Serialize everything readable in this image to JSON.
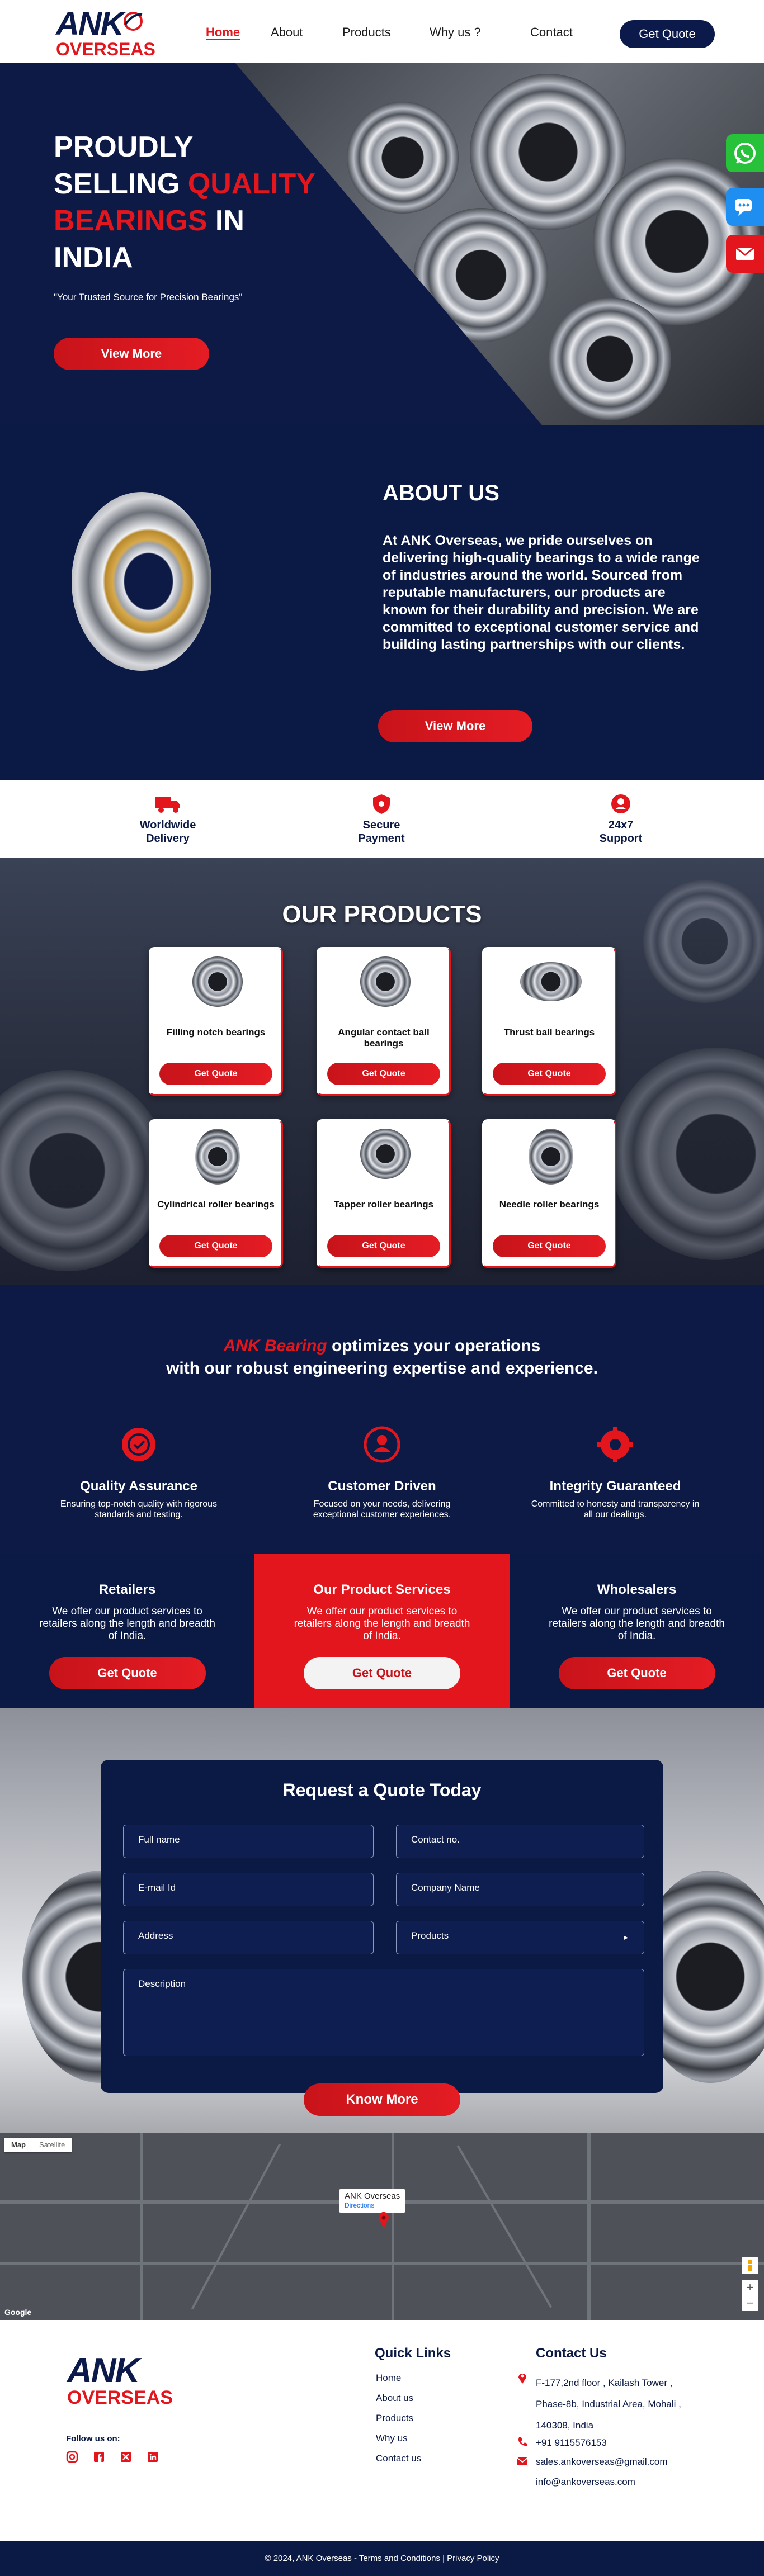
{
  "header": {
    "logo_top": "ANK",
    "logo_bottom": "OVERSEAS",
    "nav": [
      "Home",
      "About",
      "Products",
      "Why us ?",
      "Contact"
    ],
    "cta": "Get Quote"
  },
  "hero": {
    "line1": "PROUDLY",
    "line2a": "SELLING ",
    "line2b": "QUALITY",
    "line3a": "BEARINGS",
    "line3b": " IN",
    "line4": "INDIA",
    "tagline": "\"Your Trusted Source for Precision Bearings\"",
    "button": "View More"
  },
  "social": {
    "whatsapp": "whatsapp-icon",
    "chat": "chat-icon",
    "mail": "mail-icon"
  },
  "about": {
    "title": "ABOUT US",
    "text": "At ANK Overseas, we pride ourselves on delivering high-quality bearings to a wide range of industries around the world. Sourced from reputable manufacturers, our products are known for their durability and precision. We are committed to exceptional customer service and building lasting partnerships with our clients.",
    "button": "View More"
  },
  "features": [
    {
      "l1": "Worldwide",
      "l2": "Delivery",
      "icon": "truck-icon"
    },
    {
      "l1": "Secure",
      "l2": "Payment",
      "icon": "shield-icon"
    },
    {
      "l1": "24x7",
      "l2": "Support",
      "icon": "support-icon"
    }
  ],
  "products": {
    "title": "OUR PRODUCTS",
    "items": [
      {
        "name": "Filling notch bearings",
        "btn": "Get Quote"
      },
      {
        "name": "Angular contact ball bearings",
        "btn": "Get Quote"
      },
      {
        "name": "Thrust ball bearings",
        "btn": "Get Quote"
      },
      {
        "name": "Cylindrical roller bearings",
        "btn": "Get Quote"
      },
      {
        "name": "Tapper roller bearings",
        "btn": "Get Quote"
      },
      {
        "name": "Needle roller bearings",
        "btn": "Get Quote"
      }
    ]
  },
  "optimize": {
    "brand": "ANK Bearing",
    "line1": " optimizes your operations",
    "line2": "with our robust engineering expertise and experience.",
    "cols": [
      {
        "title": "Quality Assurance",
        "desc": "Ensuring top-notch quality with rigorous standards and testing."
      },
      {
        "title": "Customer Driven",
        "desc": "Focused on your needs, delivering exceptional customer experiences."
      },
      {
        "title": "Integrity Guaranteed",
        "desc": "Committed to honesty and transparency in all our dealings."
      }
    ]
  },
  "services": [
    {
      "title": "Retailers",
      "desc": "We offer our product services to retailers along the length and breadth of India.",
      "btn": "Get Quote"
    },
    {
      "title": "Our Product Services",
      "desc": "We offer our product services to retailers along the length and breadth of India.",
      "btn": "Get Quote"
    },
    {
      "title": "Wholesalers",
      "desc": "We offer our product services to retailers along the length and breadth of India.",
      "btn": "Get Quote"
    }
  ],
  "quote": {
    "title": "Request a Quote Today",
    "full_name": "Full name",
    "contact": "Contact no.",
    "email": "E-mail Id",
    "company": "Company Name",
    "address": "Address",
    "products": "Products",
    "description": "Description",
    "button": "Know More"
  },
  "map": {
    "tab_map": "Map",
    "tab_sat": "Satellite",
    "pin_title": "ANK Overseas",
    "pin_link": "Directions",
    "google": "Google"
  },
  "footer": {
    "logo_top": "ANK",
    "logo_bottom": "OVERSEAS",
    "follow": "Follow us on:",
    "quick_title": "Quick Links",
    "links": [
      "Home",
      "About us",
      "Products",
      "Why us",
      "Contact us"
    ],
    "contact_title": "Contact Us",
    "addr1": "F-177,2nd floor , Kailash Tower ,",
    "addr2": "Phase-8b, Industrial Area, Mohali ,",
    "addr3": "140308, India",
    "phone": "+91 9115576153",
    "mail1": "sales.ankoverseas@gmail.com",
    "mail2": "info@ankoverseas.com",
    "copyright": "© 2024, ANK Overseas - Terms and Conditions | Privacy Policy"
  },
  "colors": {
    "navy": "#0b1a45",
    "red": "#e3161d"
  }
}
